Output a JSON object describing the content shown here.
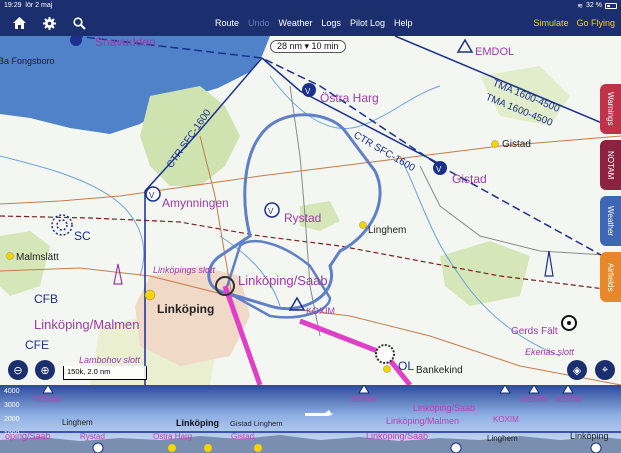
{
  "status": {
    "time": "19:29",
    "date": "lör 2 maj",
    "battery": "32 %"
  },
  "toolbar": {
    "home_icon": "home-icon",
    "settings_icon": "gear-icon",
    "search_icon": "search-icon",
    "route": "Route",
    "undo": "Undo",
    "weather": "Weather",
    "logs": "Logs",
    "pilot_log": "Pilot Log",
    "help": "Help",
    "simulate": "Simulate",
    "go_flying": "Go Flying"
  },
  "map": {
    "scale_selector": "28 nm ▾ 10 min",
    "labels": {
      "snavudden": "Snavudden",
      "fongsboro": "Ba Fongsboro",
      "emdol": "EMDOL",
      "ostra_harg": "Östra Harg",
      "tma1": "TMA 1600-4500",
      "tma2": "TMA 1600-4500",
      "ctr_sfc_left": "CTR SFC-1600",
      "ctr_sfc_right": "CTR SFC-1600",
      "gistad_small": "Gistad",
      "gistad": "Gistad",
      "amynningen": "Amynningen",
      "rystad": "Rystad",
      "linghem": "Linghem",
      "sc": "SC",
      "malmslatt": "Malmslätt",
      "linkopings_slott": "Linköpings slott",
      "linkoping_saab": "Linköping/Saab",
      "koxim": "KOXIM",
      "cfb": "CFB",
      "linkoping_malmen": "Linköping/Malmen",
      "linkoping": "Linköping",
      "cfe": "CFE",
      "lambohov": "Lambohov slott",
      "ol": "OL",
      "bankekind": "Bankekind",
      "gerds_falt": "Gerds Fält",
      "ekenas": "Ekenäs slott"
    },
    "scalebar": "150k, 2.0 nm",
    "side_tabs": {
      "warnings": "Warnings",
      "notam": "NOTAM",
      "weather": "Weather",
      "airfields": "Airfields"
    },
    "colors": {
      "warnings": "#c0314a",
      "notam": "#8a2240",
      "weather": "#3f66b5",
      "airfields": "#e8862a",
      "route": "#5f7fc7",
      "airspace": "#1b2f8e",
      "pink_route": "#e040c8"
    }
  },
  "profile": {
    "altitudes": [
      "4000",
      "3000",
      "2000",
      "1000"
    ],
    "top_labels": [
      "KOXIM",
      "KOXIM",
      "KOXIM",
      "KOXIM"
    ],
    "linghem_left": "Linghem",
    "linkoping": "Linköping",
    "gistad_linghem": "Gistad Linghem",
    "linkoping_saab": "Linköping/Saab",
    "koxim_mid": "KOXIM",
    "linkoping_malmen": "Linköping/Malmen",
    "gistad": "Gistad",
    "rystad": "Rystad",
    "ostra_harg": "Östra Harg",
    "oping_saab": "oping/Saab",
    "linkoping_saab2": "Linköping/Saab",
    "linghem_right": "Linghem",
    "linkoping_right": "Linköping"
  }
}
